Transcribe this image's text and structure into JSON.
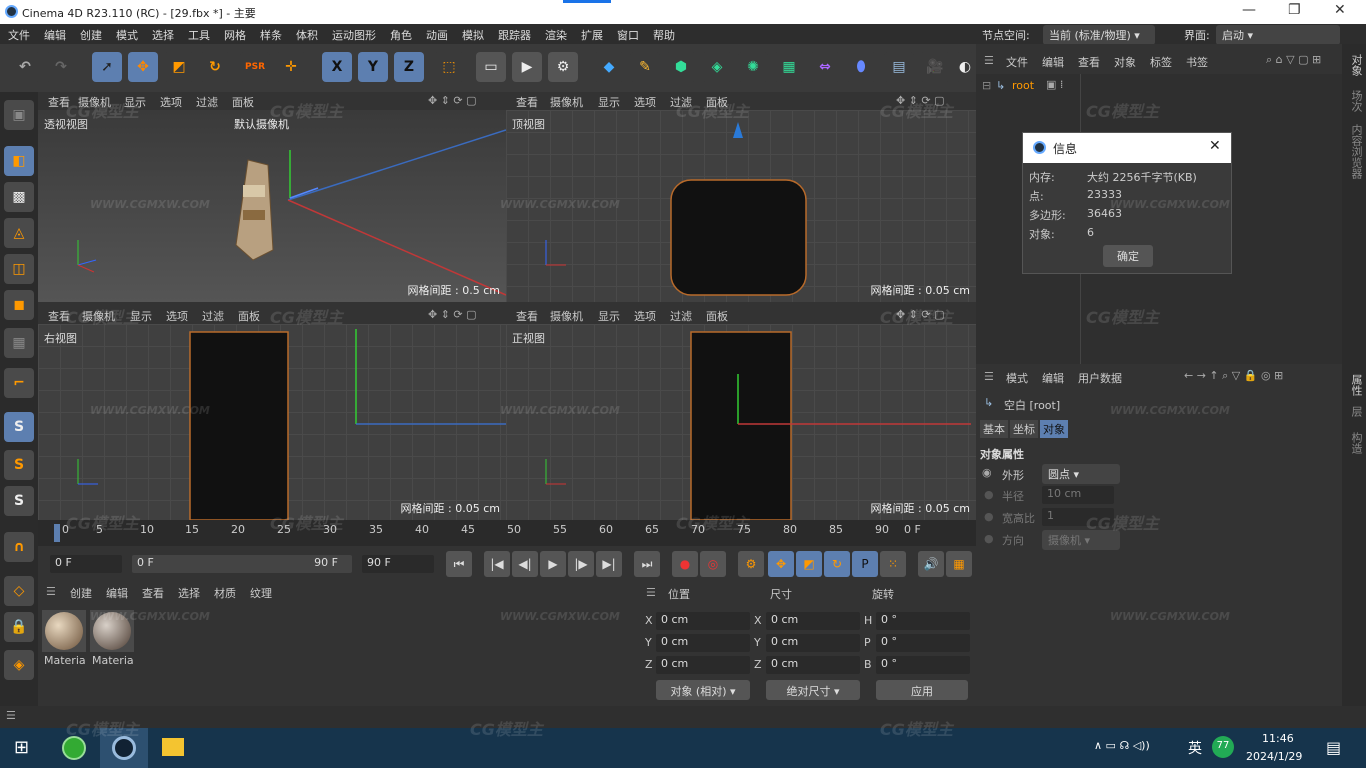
{
  "window": {
    "title": "Cinema 4D R23.110 (RC) - [29.fbx *] - 主要"
  },
  "menu": [
    "文件",
    "编辑",
    "创建",
    "模式",
    "选择",
    "工具",
    "网格",
    "样条",
    "体积",
    "运动图形",
    "角色",
    "动画",
    "模拟",
    "跟踪器",
    "渲染",
    "扩展",
    "窗口",
    "帮助"
  ],
  "node_space": {
    "label": "节点空间:",
    "value": "当前 (标准/物理)"
  },
  "layout": {
    "label": "界面:",
    "value": "启动"
  },
  "toolbar_icons": [
    "undo-icon",
    "redo-icon",
    "select-icon",
    "move-icon",
    "scale-icon",
    "rotate-icon",
    "psr-icon",
    "transform-icon",
    "x-axis-icon",
    "y-axis-icon",
    "z-axis-icon",
    "coord-system-icon",
    "render-view-icon",
    "render-icon",
    "render-settings-icon",
    "cube-icon",
    "pen-icon",
    "subdivision-icon",
    "extrude-icon",
    "cloner-icon",
    "array-icon",
    "deformer-icon",
    "field-icon",
    "floor-icon",
    "camera-icon",
    "light-icon"
  ],
  "axis_letters": [
    "X",
    "Y",
    "Z"
  ],
  "viewport_menu": [
    "查看",
    "摄像机",
    "显示",
    "选项",
    "过滤",
    "面板"
  ],
  "viewports": [
    {
      "name": "透视视图",
      "camera": "默认摄像机",
      "grid": "网格间距 : 0.5 cm"
    },
    {
      "name": "顶视图",
      "grid": "网格间距 : 0.05 cm"
    },
    {
      "name": "右视图",
      "grid": "网格间距 : 0.05 cm"
    },
    {
      "name": "正视图",
      "grid": "网格间距 : 0.05 cm"
    }
  ],
  "timeline": {
    "ticks": [
      "0",
      "5",
      "10",
      "15",
      "20",
      "25",
      "30",
      "35",
      "40",
      "45",
      "50",
      "55",
      "60",
      "65",
      "70",
      "75",
      "80",
      "85",
      "90"
    ],
    "end_label": "0 F"
  },
  "playback": {
    "current": "0 F",
    "range_start": "0 F",
    "range_end": "90 F",
    "max": "90 F"
  },
  "materials_menu": [
    "创建",
    "编辑",
    "查看",
    "选择",
    "材质",
    "纹理"
  ],
  "materials": [
    "Materia",
    "Materia"
  ],
  "coords": {
    "headers": [
      "位置",
      "尺寸",
      "旋转"
    ],
    "pos": [
      {
        "axis": "X",
        "value": "0 cm"
      },
      {
        "axis": "Y",
        "value": "0 cm"
      },
      {
        "axis": "Z",
        "value": "0 cm"
      }
    ],
    "size": [
      {
        "axis": "X",
        "value": "0 cm"
      },
      {
        "axis": "Y",
        "value": "0 cm"
      },
      {
        "axis": "Z",
        "value": "0 cm"
      }
    ],
    "rot": [
      {
        "axis": "H",
        "value": "0 °"
      },
      {
        "axis": "P",
        "value": "0 °"
      },
      {
        "axis": "B",
        "value": "0 °"
      }
    ],
    "mode": "对象 (相对)",
    "size_mode": "绝对尺寸",
    "apply": "应用"
  },
  "object_manager": {
    "menu": [
      "文件",
      "编辑",
      "查看",
      "对象",
      "标签",
      "书签"
    ],
    "root": "root"
  },
  "info_dialog": {
    "title": "信息",
    "rows": [
      {
        "k": "内存:",
        "v": "大约 2256千字节(KB)"
      },
      {
        "k": "点:",
        "v": "23333"
      },
      {
        "k": "多边形:",
        "v": "36463"
      },
      {
        "k": "对象:",
        "v": "6"
      }
    ],
    "ok": "确定"
  },
  "attributes": {
    "menu": [
      "模式",
      "编辑",
      "用户数据"
    ],
    "object": "空白 [root]",
    "tabs": [
      "基本",
      "坐标",
      "对象"
    ],
    "section": "对象属性",
    "props": [
      {
        "label": "外形",
        "value": "圆点"
      },
      {
        "label": "半径",
        "value": "10 cm"
      },
      {
        "label": "宽高比",
        "value": "1"
      },
      {
        "label": "方向",
        "value": "摄像机"
      }
    ]
  },
  "side_tabs": [
    "对象",
    "场次",
    "内容浏览器",
    "层"
  ],
  "side_tabs2": [
    "属性",
    "层",
    "构造"
  ],
  "taskbar": {
    "time": "11:46",
    "date": "2024/1/29",
    "ime": "英",
    "badge": "77"
  },
  "watermark": "CG模型主",
  "watermark_url": "WWW.CGMXW.COM"
}
